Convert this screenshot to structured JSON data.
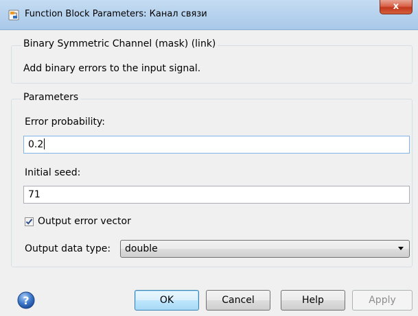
{
  "window": {
    "title": "Function Block Parameters: Канал связи",
    "close_glyph": "x"
  },
  "block": {
    "legend": "Binary Symmetric Channel (mask) (link)",
    "description": "Add binary errors to the input signal."
  },
  "parameters": {
    "legend": "Parameters",
    "error_probability": {
      "label": "Error probability:",
      "value": "0.2"
    },
    "initial_seed": {
      "label": "Initial seed:",
      "value": "71"
    },
    "output_error_vector": {
      "label": "Output error vector",
      "checked": true
    },
    "output_data_type": {
      "label": "Output data type:",
      "value": "double"
    }
  },
  "buttons": {
    "ok": "OK",
    "cancel": "Cancel",
    "help": "Help",
    "apply": "Apply"
  },
  "icons": {
    "app": "simulink-block-icon",
    "help": "question-mark-icon",
    "checkbox": "checkmark-icon",
    "dropdown": "triangle-down-icon"
  },
  "colors": {
    "titlebar": "#b6d2ee",
    "close": "#c2391d",
    "background": "#f0f0f0",
    "default_button": "#3c7fb1"
  }
}
